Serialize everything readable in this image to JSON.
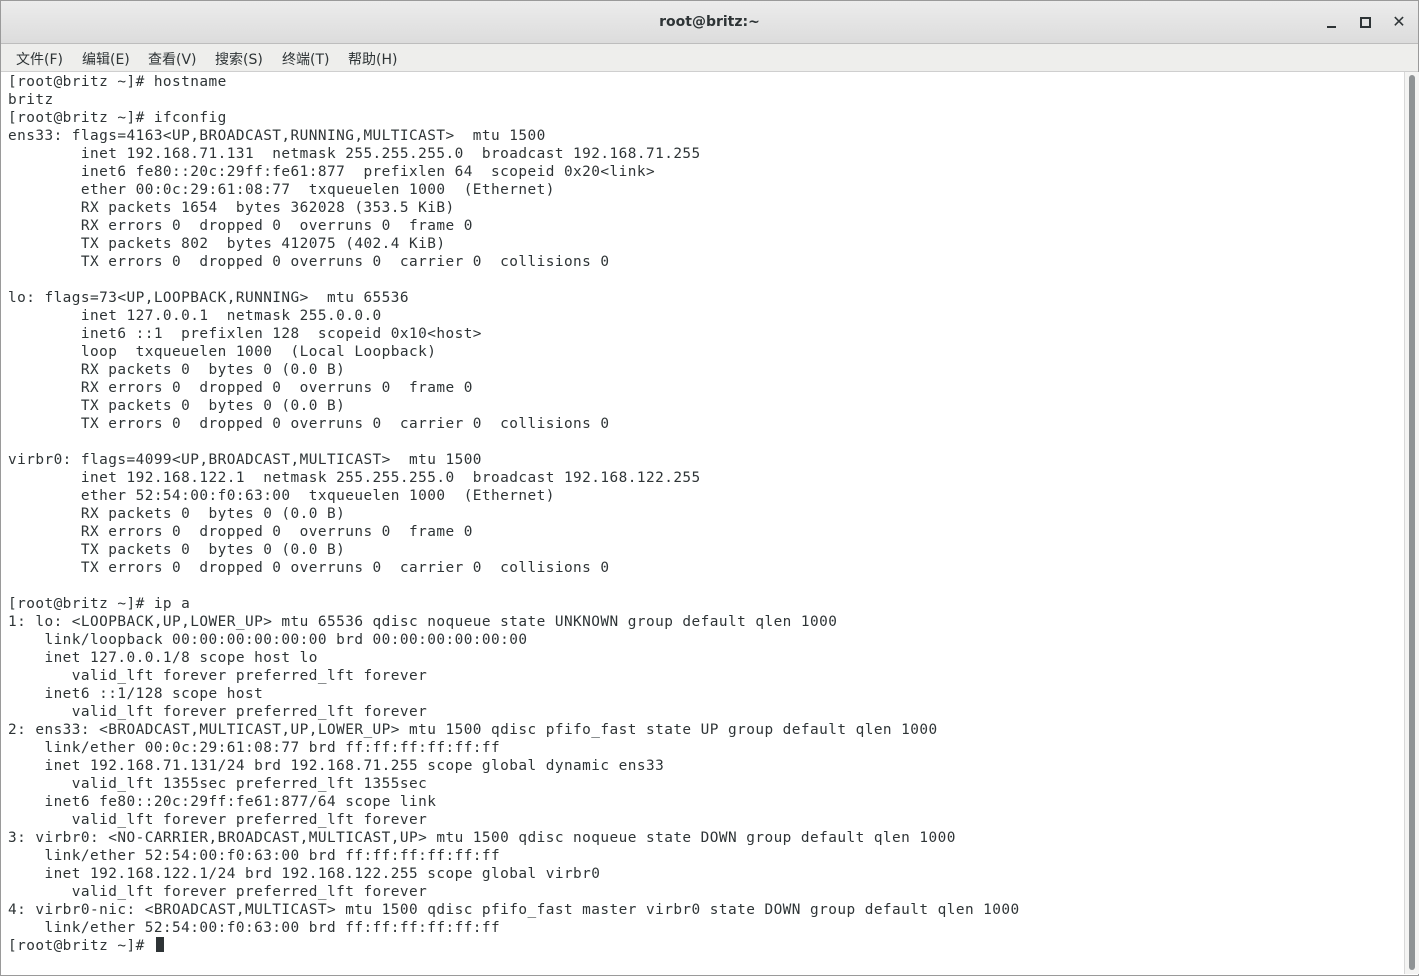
{
  "window": {
    "title": "root@britz:~",
    "buttons": {
      "minimize": "minimize-icon",
      "maximize": "maximize-icon",
      "close": "close-icon"
    }
  },
  "menu": [
    {
      "label": "文件(F)"
    },
    {
      "label": "编辑(E)"
    },
    {
      "label": "查看(V)"
    },
    {
      "label": "搜索(S)"
    },
    {
      "label": "终端(T)"
    },
    {
      "label": "帮助(H)"
    }
  ],
  "terminal": {
    "lines": [
      "[root@britz ~]# hostname",
      "britz",
      "[root@britz ~]# ifconfig",
      "ens33: flags=4163<UP,BROADCAST,RUNNING,MULTICAST>  mtu 1500",
      "        inet 192.168.71.131  netmask 255.255.255.0  broadcast 192.168.71.255",
      "        inet6 fe80::20c:29ff:fe61:877  prefixlen 64  scopeid 0x20<link>",
      "        ether 00:0c:29:61:08:77  txqueuelen 1000  (Ethernet)",
      "        RX packets 1654  bytes 362028 (353.5 KiB)",
      "        RX errors 0  dropped 0  overruns 0  frame 0",
      "        TX packets 802  bytes 412075 (402.4 KiB)",
      "        TX errors 0  dropped 0 overruns 0  carrier 0  collisions 0",
      "",
      "lo: flags=73<UP,LOOPBACK,RUNNING>  mtu 65536",
      "        inet 127.0.0.1  netmask 255.0.0.0",
      "        inet6 ::1  prefixlen 128  scopeid 0x10<host>",
      "        loop  txqueuelen 1000  (Local Loopback)",
      "        RX packets 0  bytes 0 (0.0 B)",
      "        RX errors 0  dropped 0  overruns 0  frame 0",
      "        TX packets 0  bytes 0 (0.0 B)",
      "        TX errors 0  dropped 0 overruns 0  carrier 0  collisions 0",
      "",
      "virbr0: flags=4099<UP,BROADCAST,MULTICAST>  mtu 1500",
      "        inet 192.168.122.1  netmask 255.255.255.0  broadcast 192.168.122.255",
      "        ether 52:54:00:f0:63:00  txqueuelen 1000  (Ethernet)",
      "        RX packets 0  bytes 0 (0.0 B)",
      "        RX errors 0  dropped 0  overruns 0  frame 0",
      "        TX packets 0  bytes 0 (0.0 B)",
      "        TX errors 0  dropped 0 overruns 0  carrier 0  collisions 0",
      "",
      "[root@britz ~]# ip a",
      "1: lo: <LOOPBACK,UP,LOWER_UP> mtu 65536 qdisc noqueue state UNKNOWN group default qlen 1000",
      "    link/loopback 00:00:00:00:00:00 brd 00:00:00:00:00:00",
      "    inet 127.0.0.1/8 scope host lo",
      "       valid_lft forever preferred_lft forever",
      "    inet6 ::1/128 scope host",
      "       valid_lft forever preferred_lft forever",
      "2: ens33: <BROADCAST,MULTICAST,UP,LOWER_UP> mtu 1500 qdisc pfifo_fast state UP group default qlen 1000",
      "    link/ether 00:0c:29:61:08:77 brd ff:ff:ff:ff:ff:ff",
      "    inet 192.168.71.131/24 brd 192.168.71.255 scope global dynamic ens33",
      "       valid_lft 1355sec preferred_lft 1355sec",
      "    inet6 fe80::20c:29ff:fe61:877/64 scope link",
      "       valid_lft forever preferred_lft forever",
      "3: virbr0: <NO-CARRIER,BROADCAST,MULTICAST,UP> mtu 1500 qdisc noqueue state DOWN group default qlen 1000",
      "    link/ether 52:54:00:f0:63:00 brd ff:ff:ff:ff:ff:ff",
      "    inet 192.168.122.1/24 brd 192.168.122.255 scope global virbr0",
      "       valid_lft forever preferred_lft forever",
      "4: virbr0-nic: <BROADCAST,MULTICAST> mtu 1500 qdisc pfifo_fast master virbr0 state DOWN group default qlen 1000",
      "    link/ether 52:54:00:f0:63:00 brd ff:ff:ff:ff:ff:ff"
    ],
    "prompt": "[root@britz ~]# "
  },
  "colors": {
    "text": "#2e3436",
    "background": "#ffffff",
    "menubar": "#eeeeec",
    "titlebar": "#dcdcdc"
  }
}
